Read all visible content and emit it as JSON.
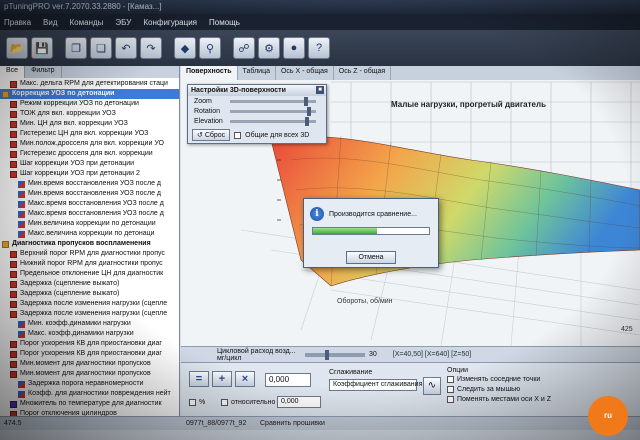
{
  "window": {
    "title": "pTuningPRO ver.7.2070.33.2880 - [Камаз...]"
  },
  "menu": [
    "Правка",
    "Вид",
    "Команды",
    "ЭБУ",
    "Конфигурация",
    "Помощь"
  ],
  "toolbar_icons": [
    "open-icon",
    "save-icon",
    "copy-icon",
    "paste-icon",
    "undo-icon",
    "redo-icon",
    "compare-icon",
    "search-icon",
    "connect-icon",
    "ecu-icon",
    "reset-icon",
    "help-icon"
  ],
  "left_tabs": [
    "Все",
    "Фильтр"
  ],
  "tree": [
    {
      "label": "Макс. дельта RPM для детектирования стаци",
      "icon": "table",
      "level": 1
    },
    {
      "label": "Коррекция УОЗ по детонации",
      "icon": "folder",
      "level": 0,
      "selected": true
    },
    {
      "label": "Режим коррекции УОЗ по детонации",
      "icon": "table",
      "level": 1
    },
    {
      "label": "ТОЖ для вкл. коррекции УОЗ",
      "icon": "table",
      "level": 1
    },
    {
      "label": "Мин. ЦН для вкл. коррекции УОЗ",
      "icon": "table",
      "level": 1
    },
    {
      "label": "Гистерезис ЦН для вкл. коррекции УОЗ",
      "icon": "table",
      "level": 1
    },
    {
      "label": "Мин.полож.дросселя для вкл. коррекции УО",
      "icon": "table",
      "level": 1
    },
    {
      "label": "Гистерезис дросселя для вкл. коррекции",
      "icon": "table",
      "level": 1
    },
    {
      "label": "Шаг коррекции УОЗ при детонации",
      "icon": "table",
      "level": 1
    },
    {
      "label": "Шаг коррекции УОЗ при детонации 2",
      "icon": "table",
      "level": 1
    },
    {
      "label": "Мин.время восстановления УОЗ после д",
      "icon": "chart",
      "level": 2
    },
    {
      "label": "Мин.время восстановления УОЗ после д",
      "icon": "chart",
      "level": 2
    },
    {
      "label": "Макс.время восстановления УОЗ после д",
      "icon": "chart",
      "level": 2
    },
    {
      "label": "Макс.время восстановления УОЗ после д",
      "icon": "chart",
      "level": 2
    },
    {
      "label": "Мин.величина коррекции по детонации",
      "icon": "chart",
      "level": 2
    },
    {
      "label": "Макс.величина коррекции по детонаци",
      "icon": "chart",
      "level": 2
    },
    {
      "label": "Диагностика пропусков воспламенения",
      "icon": "folder",
      "level": 0
    },
    {
      "label": "Верхний порог RPM для диагностики пропус",
      "icon": "table",
      "level": 1
    },
    {
      "label": "Нижний порог RPM для диагностики пропус",
      "icon": "table",
      "level": 1
    },
    {
      "label": "Предельное отклонение ЦН для диагностик",
      "icon": "table",
      "level": 1
    },
    {
      "label": "Задержка (сцепление выжато)",
      "icon": "table",
      "level": 1
    },
    {
      "label": "Задержка (сцепление выжато)",
      "icon": "table",
      "level": 1
    },
    {
      "label": "Задержка после изменения нагрузки (сцепле",
      "icon": "table",
      "level": 1
    },
    {
      "label": "Задержка после изменения нагрузки (сцепле",
      "icon": "table",
      "level": 1
    },
    {
      "label": "Мин. коэфф.динамики нагрузки",
      "icon": "chart",
      "level": 2
    },
    {
      "label": "Макс. коэфф.динамики нагрузки",
      "icon": "chart",
      "level": 2
    },
    {
      "label": "Порог ускорения КВ для приостановки диаг",
      "icon": "table",
      "level": 1
    },
    {
      "label": "Порог ускорения КВ для приостановки диаг",
      "icon": "table",
      "level": 1
    },
    {
      "label": "Мин.момент для диагностики пропусков",
      "icon": "table",
      "level": 1
    },
    {
      "label": "Мин.момент для диагностики пропусков",
      "icon": "table",
      "level": 1
    },
    {
      "label": "Задержка порога неравномерности",
      "icon": "chart",
      "level": 2
    },
    {
      "label": "Коэфф. для диагностики повреждения нейт",
      "icon": "chart",
      "level": 2
    },
    {
      "label": "Множитель по температуре для диагностик",
      "icon": "graph",
      "level": 1
    },
    {
      "label": "Порог отключения цилиндров",
      "icon": "table",
      "level": 1
    }
  ],
  "right_tabs": [
    "Поверхность",
    "Таблица",
    "Ось X - общая",
    "Ось Z - общая"
  ],
  "plot": {
    "title": "Малые нагрузки, прогретый двигатель",
    "axis_label": "Обороты, об/мин",
    "tick": "425"
  },
  "settings3d": {
    "title": "Настройки 3D-поверхности",
    "rows": [
      {
        "label": "Zoom",
        "value": 0.88
      },
      {
        "label": "Rotation",
        "value": 0.92
      },
      {
        "label": "Elevation",
        "value": 0.9
      }
    ],
    "reset_label": "Сброс",
    "common_label": "Общие для всех 3D"
  },
  "dialog": {
    "message": "Производится сравнение...",
    "cancel_label": "Отмена",
    "progress": 0.55
  },
  "axis_bar": {
    "name_line1": "Цикловой расход возд...",
    "name_line2": "мг/цикл",
    "step": "30",
    "status": "[X=40,50] [X=640] [Z=50]"
  },
  "bottom": {
    "value": "0,000",
    "pct_label": "%",
    "rel_label": "относительно",
    "rel_value": "0,000",
    "smooth_title": "Сглаживание",
    "smooth_coef_label": "Коэффициент сглаживания",
    "options_title": "Опции",
    "options": [
      "Изменять соседние точки",
      "Следить за мышью",
      "Поменять местами оси X и Z"
    ]
  },
  "statusbar": {
    "left": "474.5",
    "mid": "0977t_88/0977t_92",
    "right": "Сравнить прошивки"
  },
  "brand": "ru"
}
